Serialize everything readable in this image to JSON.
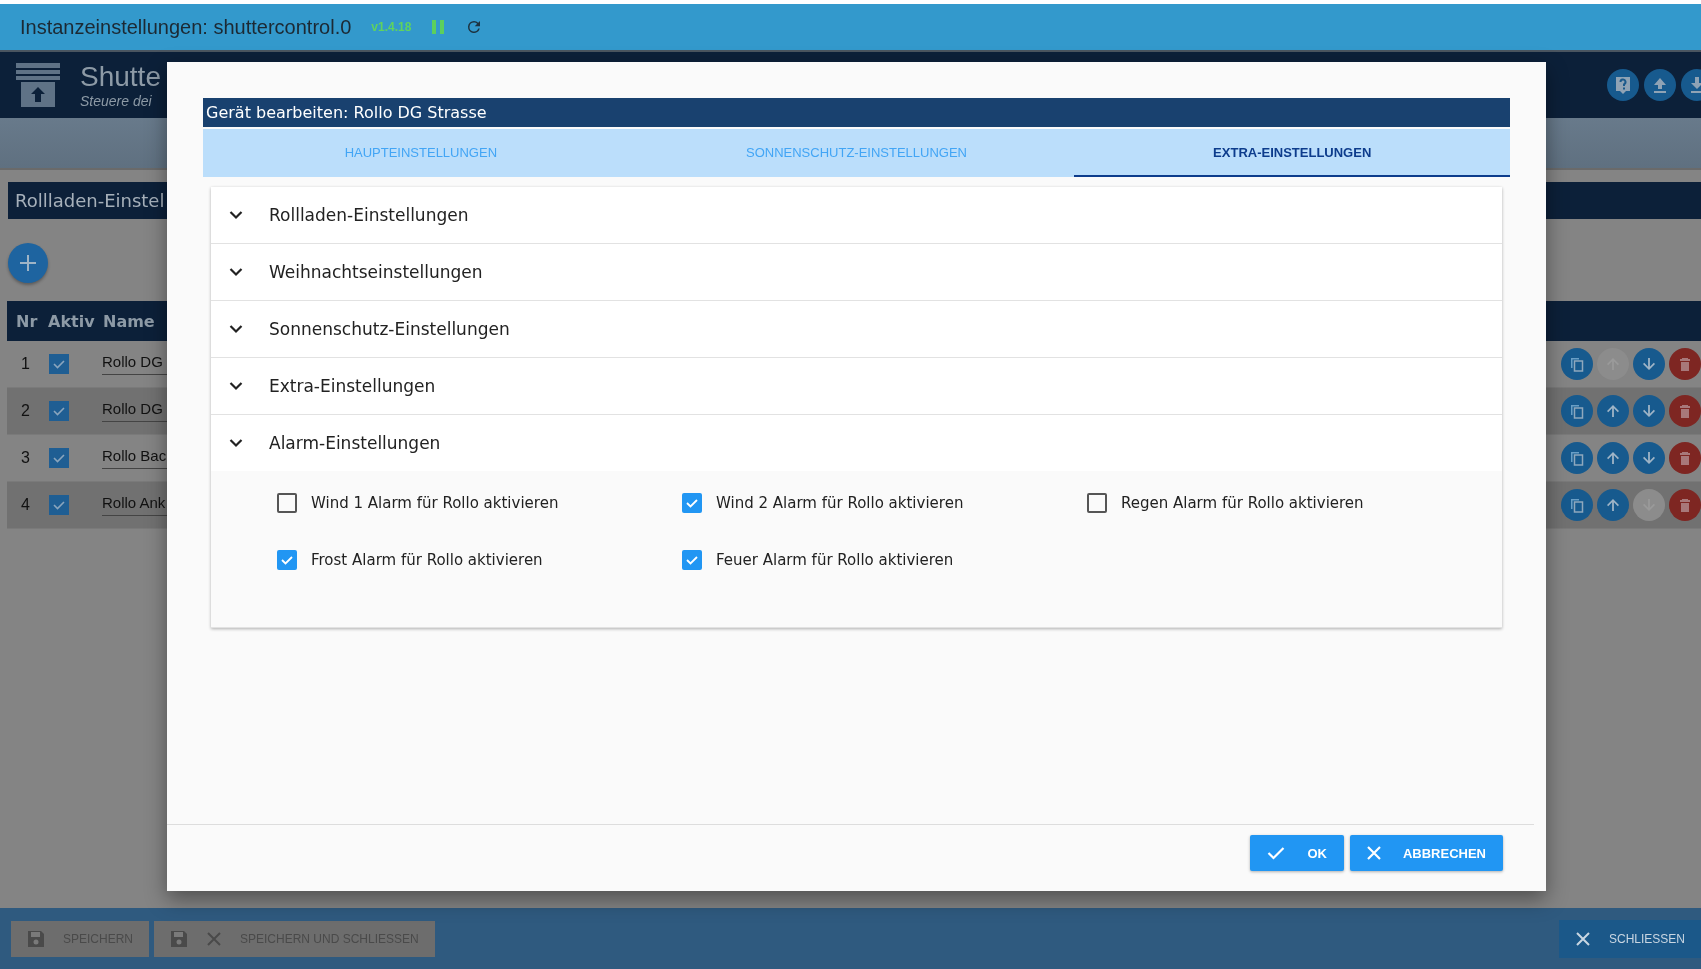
{
  "top_bar": {
    "title": "Instanzeinstellungen: shuttercontrol.0",
    "version": "v1.4.18"
  },
  "app_header": {
    "title": "Shutte",
    "subtitle": "Steuere dei"
  },
  "section_title": "Rollladen-Einstel",
  "table": {
    "columns": [
      "Nr",
      "Aktiv",
      "Name"
    ],
    "rows": [
      {
        "nr": "1",
        "active": true,
        "name": "Rollo DG",
        "up_enabled": false,
        "down_enabled": true
      },
      {
        "nr": "2",
        "active": true,
        "name": "Rollo DG",
        "up_enabled": true,
        "down_enabled": true
      },
      {
        "nr": "3",
        "active": true,
        "name": "Rollo Bac",
        "up_enabled": true,
        "down_enabled": true
      },
      {
        "nr": "4",
        "active": true,
        "name": "Rollo Ank",
        "up_enabled": true,
        "down_enabled": false
      }
    ]
  },
  "dialog": {
    "title": "Gerät bearbeiten: Rollo DG Strasse",
    "tabs": [
      {
        "label": "HAUPTEINSTELLUNGEN",
        "selected": false
      },
      {
        "label": "SONNENSCHUTZ-EINSTELLUNGEN",
        "selected": false
      },
      {
        "label": "EXTRA-EINSTELLUNGEN",
        "selected": true
      }
    ],
    "sections": [
      {
        "label": "Rollladen-Einstellungen",
        "expanded": false
      },
      {
        "label": "Weihnachtseinstellungen",
        "expanded": false
      },
      {
        "label": "Sonnenschutz-Einstellungen",
        "expanded": false
      },
      {
        "label": "Extra-Einstellungen",
        "expanded": false
      },
      {
        "label": "Alarm-Einstellungen",
        "expanded": true,
        "options": [
          {
            "label": "Wind 1 Alarm für Rollo aktivieren",
            "checked": false
          },
          {
            "label": "Wind 2 Alarm für Rollo aktivieren",
            "checked": true
          },
          {
            "label": "Regen Alarm für Rollo aktivieren",
            "checked": false
          },
          {
            "label": "Frost Alarm für Rollo aktivieren",
            "checked": true
          },
          {
            "label": "Feuer Alarm für Rollo aktivieren",
            "checked": true
          }
        ]
      }
    ],
    "buttons": [
      {
        "kind": "ok",
        "label": "OK"
      },
      {
        "kind": "cancel",
        "label": "ABBRECHEN"
      }
    ]
  },
  "bottom_bar": {
    "buttons": [
      {
        "kind": "save",
        "label": "SPEICHERN",
        "disabled": true
      },
      {
        "kind": "save_close",
        "label": "SPEICHERN UND SCHLIESSEN",
        "disabled": true
      },
      {
        "kind": "close",
        "label": "SCHLIESSEN",
        "disabled": false
      }
    ]
  }
}
